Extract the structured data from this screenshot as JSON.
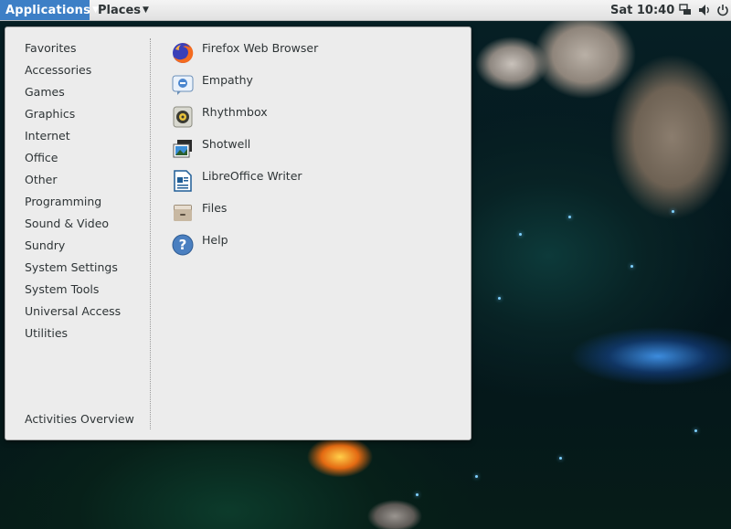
{
  "top_bar": {
    "applications_label": "Applications",
    "places_label": "Places",
    "clock": "Sat 10:40",
    "tray_icons": [
      "network-icon",
      "volume-icon",
      "power-icon"
    ]
  },
  "menu": {
    "categories": [
      "Favorites",
      "Accessories",
      "Games",
      "Graphics",
      "Internet",
      "Office",
      "Other",
      "Programming",
      "Sound & Video",
      "Sundry",
      "System Settings",
      "System Tools",
      "Universal Access",
      "Utilities"
    ],
    "activities_label": "Activities Overview",
    "apps": [
      {
        "label": "Firefox Web Browser",
        "icon": "firefox-icon"
      },
      {
        "label": "Empathy",
        "icon": "empathy-icon"
      },
      {
        "label": "Rhythmbox",
        "icon": "rhythmbox-icon"
      },
      {
        "label": "Shotwell",
        "icon": "shotwell-icon"
      },
      {
        "label": "LibreOffice Writer",
        "icon": "libreoffice-writer-icon"
      },
      {
        "label": "Files",
        "icon": "files-icon"
      },
      {
        "label": "Help",
        "icon": "help-icon"
      }
    ]
  },
  "colors": {
    "panel_active": "#3d7fc6",
    "menu_background": "#ececec",
    "text": "#2e3436"
  }
}
